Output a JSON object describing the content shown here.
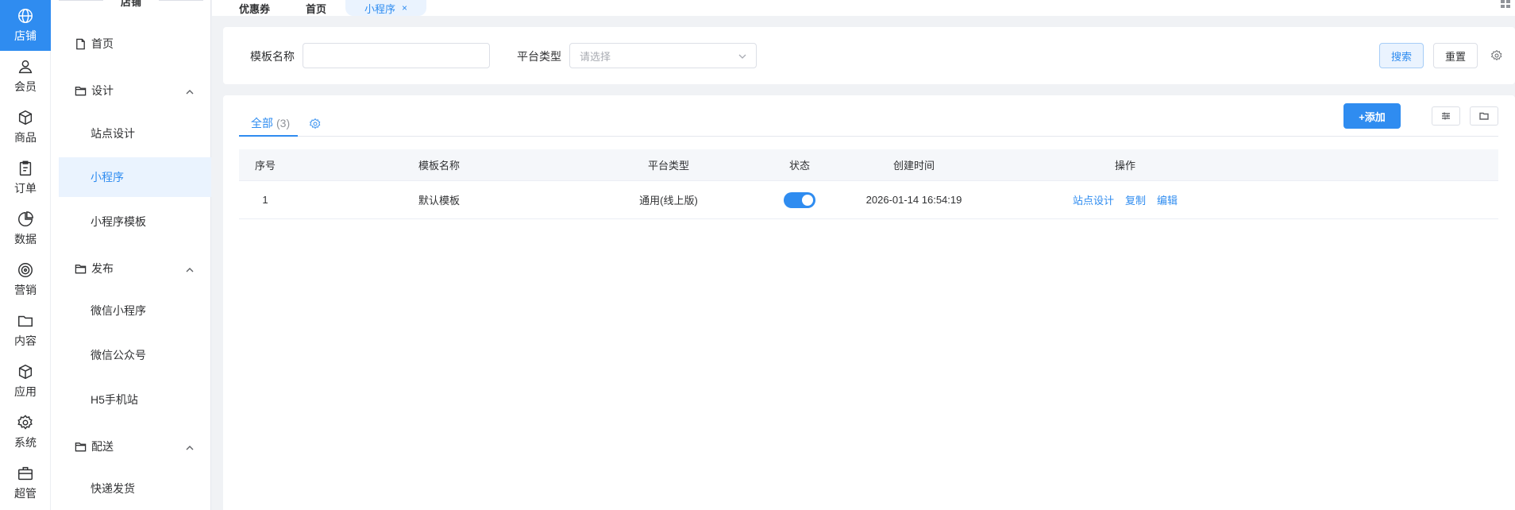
{
  "rail": [
    {
      "label": "店铺",
      "icon": "globe-icon",
      "active": true
    },
    {
      "label": "会员",
      "icon": "user-icon"
    },
    {
      "label": "商品",
      "icon": "box-icon"
    },
    {
      "label": "订单",
      "icon": "clipboard-icon"
    },
    {
      "label": "数据",
      "icon": "pie-chart-icon"
    },
    {
      "label": "营销",
      "icon": "target-icon"
    },
    {
      "label": "内容",
      "icon": "folder-icon"
    },
    {
      "label": "应用",
      "icon": "cube-icon"
    },
    {
      "label": "系统",
      "icon": "gear-icon"
    },
    {
      "label": "超管",
      "icon": "briefcase-icon"
    }
  ],
  "sidebar": {
    "header": "店铺",
    "items": [
      {
        "label": "首页"
      },
      {
        "label": "设计"
      },
      {
        "label": "站点设计"
      },
      {
        "label": "小程序"
      },
      {
        "label": "小程序模板"
      },
      {
        "label": "发布"
      },
      {
        "label": "微信小程序"
      },
      {
        "label": "微信公众号"
      },
      {
        "label": "H5手机站"
      },
      {
        "label": "配送"
      },
      {
        "label": "快递发货"
      }
    ]
  },
  "tabs": [
    {
      "label": "优惠券"
    },
    {
      "label": "首页"
    },
    {
      "label": "小程序",
      "close": "×"
    }
  ],
  "search": {
    "name_label": "模板名称",
    "name_value": "",
    "platform_label": "平台类型",
    "platform_placeholder": "请选择",
    "search_button": "搜索",
    "reset_button": "重置"
  },
  "main": {
    "tab_label": "全部",
    "tab_count": "(3)",
    "add_button": "+添加",
    "columns": [
      "序号",
      "模板名称",
      "平台类型",
      "状态",
      "创建时间",
      "操作"
    ],
    "rows": [
      {
        "index": "1",
        "name": "默认模板",
        "platform": "通用(线上版)",
        "status_on": true,
        "created": "2026-01-14 16:54:19",
        "actions": [
          "站点设计",
          "复制",
          "编辑"
        ]
      }
    ]
  },
  "colors": {
    "primary": "#2f8cf0",
    "active_bg": "#eaf3fe"
  }
}
